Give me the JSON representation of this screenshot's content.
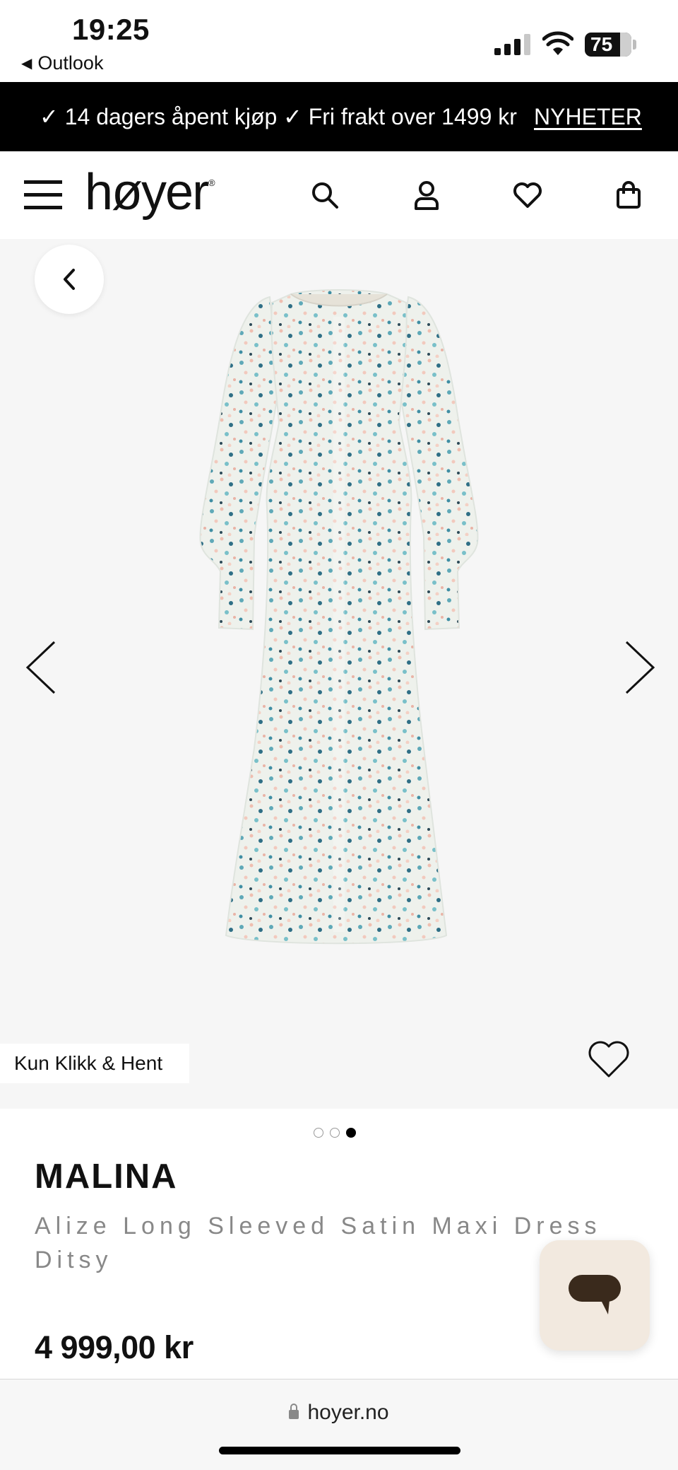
{
  "status_bar": {
    "time": "19:25",
    "back_app": "Outlook",
    "battery": "75"
  },
  "promo": {
    "item1": "✓ 14 dagers åpent kjøp",
    "item2": "✓ Fri frakt over 1499 kr",
    "link": "NYHETER"
  },
  "header": {
    "logo": "høyer",
    "logo_mark": "®",
    "icons": [
      "menu-icon",
      "search-icon",
      "user-icon",
      "heart-icon",
      "bag-icon"
    ]
  },
  "gallery": {
    "badge": "Kun Klikk & Hent",
    "image_count": 3,
    "active_index": 2
  },
  "product": {
    "brand": "MALINA",
    "name": "Alize Long Sleeved Satin Maxi Dress Ditsy",
    "price": "4 999,00 kr"
  },
  "browser": {
    "url": "hoyer.no"
  },
  "colors": {
    "promo_bg": "#000000",
    "gallery_bg": "#f6f6f6",
    "chat_bg": "#f2e9df",
    "chat_icon": "#3a2a1c"
  }
}
